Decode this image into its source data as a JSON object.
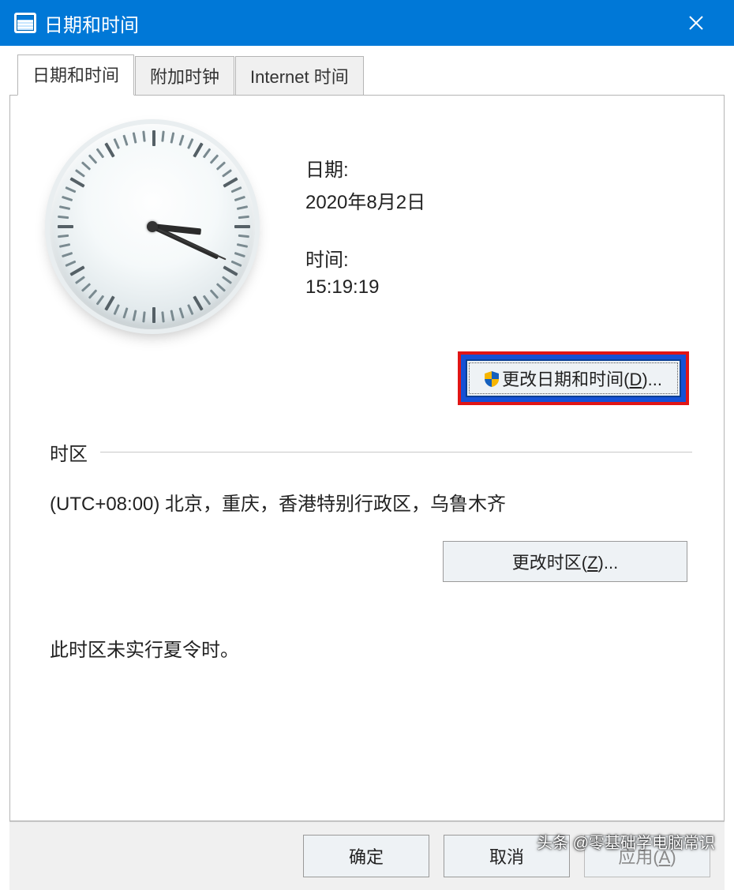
{
  "title": "日期和时间",
  "tabs": [
    {
      "label": "日期和时间",
      "active": true
    },
    {
      "label": "附加时钟",
      "active": false
    },
    {
      "label": "Internet 时间",
      "active": false
    }
  ],
  "datetime": {
    "date_label": "日期:",
    "date_value": "2020年8月2日",
    "time_label": "时间:",
    "time_value": "15:19:19",
    "change_button_shield": true,
    "change_button_text": "更改日期和时间(",
    "change_button_key": "D",
    "change_button_suffix": ")..."
  },
  "timezone": {
    "header": "时区",
    "value": "(UTC+08:00) 北京，重庆，香港特别行政区，乌鲁木齐",
    "change_button_text": "更改时区(",
    "change_button_key": "Z",
    "change_button_suffix": ")...",
    "dst_note": "此时区未实行夏令时。"
  },
  "buttons": {
    "ok": "确定",
    "cancel": "取消",
    "apply_text": "应用(",
    "apply_key": "A",
    "apply_suffix": ")"
  },
  "watermark": "头条 @零基础学电脑常识"
}
